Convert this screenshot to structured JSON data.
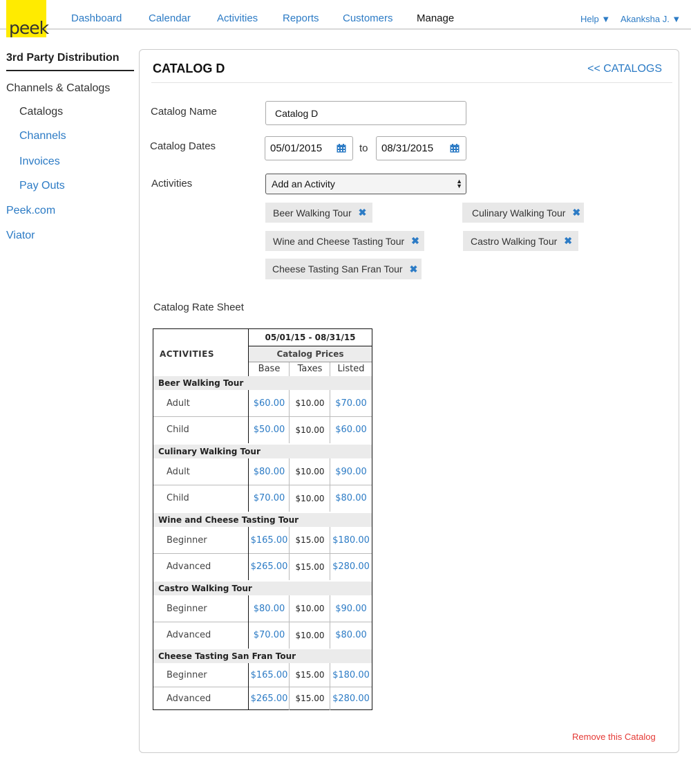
{
  "logo": "peek",
  "nav": {
    "items": [
      "Dashboard",
      "Calendar",
      "Activities",
      "Reports",
      "Customers",
      "Manage"
    ],
    "help": "Help ▼",
    "user": "Akanksha J. ▼"
  },
  "sidebar": {
    "heading": "3rd Party Distribution",
    "channels_catalogs": "Channels & Catalogs",
    "catalogs": "Catalogs",
    "channels": "Channels",
    "invoices": "Invoices",
    "payouts": "Pay Outs",
    "peek_com": "Peek.com",
    "viator": "Viator"
  },
  "panel": {
    "title": "CATALOG D",
    "back_link": "<<  CATALOGS",
    "catalog_name_label": "Catalog Name",
    "catalog_name_value": "Catalog D",
    "catalog_dates_label": "Catalog Dates",
    "date_from": "05/01/2015",
    "to_label": "to",
    "date_to": "08/31/2015",
    "activities_label": "Activities",
    "add_activity": "Add an Activity",
    "tags": [
      "Beer Walking Tour",
      "Culinary Walking Tour",
      "Wine and Cheese Tasting Tour",
      "Castro Walking Tour",
      "Cheese Tasting San Fran Tour"
    ],
    "tag_remove_glyph": "✖",
    "rate_sheet_title": "Catalog Rate Sheet",
    "remove_catalog": "Remove this Catalog"
  },
  "rate_sheet": {
    "activities_header": "ACTIVITIES",
    "date_range": "05/01/15 - 08/31/15",
    "catalog_prices": "Catalog Prices",
    "columns": [
      "Base",
      "Taxes",
      "Listed"
    ],
    "groups": [
      {
        "name": "Beer Walking Tour",
        "rows": [
          {
            "tier": "Adult",
            "base": "$60.00",
            "taxes": "$10.00",
            "listed": "$70.00"
          },
          {
            "tier": "Child",
            "base": "$50.00",
            "taxes": "$10.00",
            "listed": "$60.00"
          }
        ]
      },
      {
        "name": "Culinary Walking Tour",
        "rows": [
          {
            "tier": "Adult",
            "base": "$80.00",
            "taxes": "$10.00",
            "listed": "$90.00"
          },
          {
            "tier": "Child",
            "base": "$70.00",
            "taxes": "$10.00",
            "listed": "$80.00"
          }
        ]
      },
      {
        "name": "Wine and Cheese Tasting Tour",
        "rows": [
          {
            "tier": "Beginner",
            "base": "$165.00",
            "taxes": "$15.00",
            "listed": "$180.00"
          },
          {
            "tier": "Advanced",
            "base": "$265.00",
            "taxes": "$15.00",
            "listed": "$280.00"
          }
        ]
      },
      {
        "name": "Castro Walking Tour",
        "rows": [
          {
            "tier": "Beginner",
            "base": "$80.00",
            "taxes": "$10.00",
            "listed": "$90.00"
          },
          {
            "tier": "Advanced",
            "base": "$70.00",
            "taxes": "$10.00",
            "listed": "$80.00"
          }
        ]
      },
      {
        "name": "Cheese Tasting San Fran Tour",
        "rows": [
          {
            "tier": "Beginner",
            "base": "$165.00",
            "taxes": "$15.00",
            "listed": "$180.00"
          },
          {
            "tier": "Advanced",
            "base": "$265.00",
            "taxes": "$15.00",
            "listed": "$280.00"
          }
        ]
      }
    ]
  },
  "colors": {
    "accent": "#2c7bc5",
    "logo_bg": "#ffeb00",
    "danger": "#e53935"
  }
}
